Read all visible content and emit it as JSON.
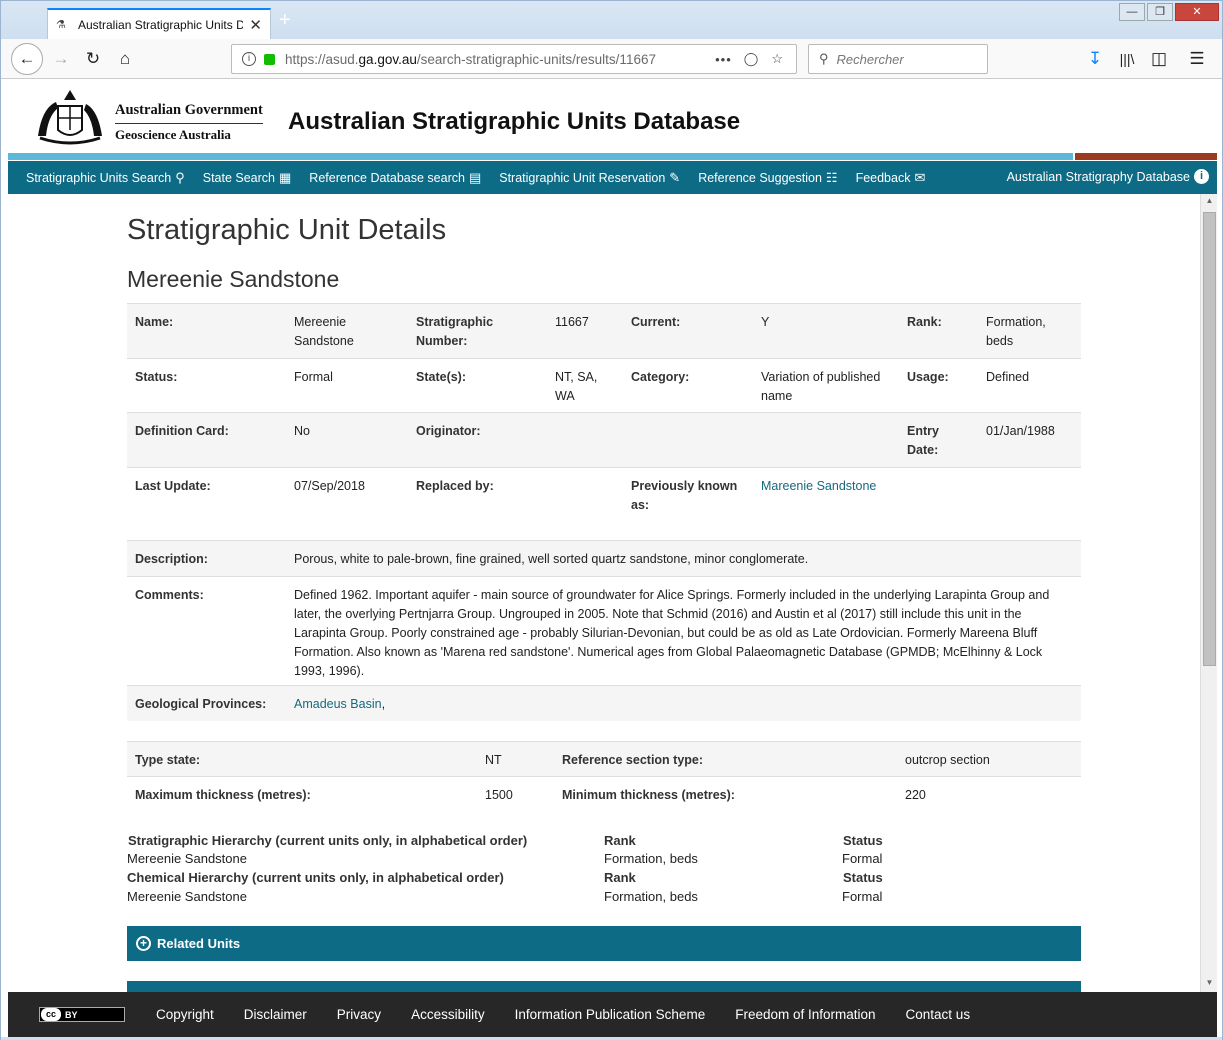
{
  "browser": {
    "tab_title": "Australian Stratigraphic Units D",
    "url_prefix": "https://asud.",
    "url_domain": "ga.gov.au",
    "url_path": "/search-stratigraphic-units/results/11667",
    "search_placeholder": "Rechercher"
  },
  "site": {
    "gov_name": "Australian Government",
    "agency": "Geoscience Australia",
    "title": "Australian Stratigraphic Units Database"
  },
  "nav": {
    "items": [
      {
        "label": "Stratigraphic Units Search",
        "icon": "search-icon"
      },
      {
        "label": "State Search",
        "icon": "map-icon"
      },
      {
        "label": "Reference Database search",
        "icon": "book-icon"
      },
      {
        "label": "Stratigraphic Unit Reservation",
        "icon": "pencil-icon"
      },
      {
        "label": "Reference Suggestion",
        "icon": "document-icon"
      },
      {
        "label": "Feedback",
        "icon": "envelope-icon"
      }
    ],
    "right": "Australian Stratigraphy Database"
  },
  "page": {
    "heading": "Stratigraphic Unit Details",
    "unit_name": "Mereenie Sandstone"
  },
  "details": {
    "name_label": "Name:",
    "name": "Mereenie Sandstone",
    "strat_num_label": "Stratigraphic Number:",
    "strat_num": "11667",
    "current_label": "Current:",
    "current": "Y",
    "rank_label": "Rank:",
    "rank": "Formation, beds",
    "status_label": "Status:",
    "status": "Formal",
    "states_label": "State(s):",
    "states": "NT, SA, WA",
    "category_label": "Category:",
    "category": "Variation of published name",
    "usage_label": "Usage:",
    "usage": "Defined",
    "defcard_label": "Definition Card:",
    "defcard": "No",
    "originator_label": "Originator:",
    "entry_label": "Entry Date:",
    "entry": "01/Jan/1988",
    "lastupdate_label": "Last Update:",
    "lastupdate": "07/Sep/2018",
    "replaced_label": "Replaced by:",
    "prevknown_label": "Previously known as:",
    "prevknown": "Mareenie Sandstone",
    "description_label": "Description:",
    "description": "Porous, white to pale-brown, fine grained, well sorted quartz sandstone, minor conglomerate.",
    "comments_label": "Comments:",
    "comments": "Defined 1962. Important aquifer - main source of groundwater for Alice Springs. Formerly included in the underlying Larapinta Group and later, the overlying Pertnjarra Group. Ungrouped in 2005. Note that Schmid (2016) and Austin et al (2017) still include this unit in the Larapinta Group. Poorly constrained age - probably Silurian-Devonian, but could be as old as Late Ordovician. Formerly Mareena Bluff Formation. Also known as 'Marena red sandstone'. Numerical ages from Global Palaeomagnetic Database (GPMDB; McElhinny & Lock 1993, 1996).",
    "provinces_label": "Geological Provinces:",
    "province": "Amadeus Basin",
    "province_sep": ","
  },
  "section": {
    "type_state_label": "Type state:",
    "type_state": "NT",
    "ref_type_label": "Reference section type:",
    "ref_type": "outcrop section",
    "max_label": "Maximum thickness (metres):",
    "max": "1500",
    "min_label": "Minimum thickness (metres):",
    "min": "220"
  },
  "hierarchy": {
    "strat_title": "Stratigraphic Hierarchy (current units only, in alphabetical order)",
    "chem_title": "Chemical Hierarchy (current units only, in alphabetical order)",
    "rank_h": "Rank",
    "status_h": "Status",
    "strat_unit": "Mereenie Sandstone",
    "strat_rank": "Formation, beds",
    "strat_status": "Formal",
    "chem_unit": "Mereenie Sandstone",
    "chem_rank": "Formation, beds",
    "chem_status": "Formal"
  },
  "accordions": {
    "related": "Related Units"
  },
  "footer": {
    "license": "BY",
    "links": [
      "Copyright",
      "Disclaimer",
      "Privacy",
      "Accessibility",
      "Information Publication Scheme",
      "Freedom of Information",
      "Contact us"
    ]
  }
}
